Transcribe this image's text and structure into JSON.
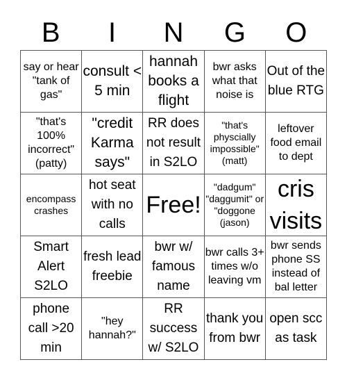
{
  "header": {
    "letters": [
      "B",
      "I",
      "N",
      "G",
      "O"
    ]
  },
  "board": {
    "rows": [
      [
        {
          "text": "say or hear \"tank of gas\"",
          "size": "s"
        },
        {
          "text": "consult < 5 min",
          "size": "l"
        },
        {
          "text": "hannah books a flight",
          "size": "l"
        },
        {
          "text": "bwr asks what that noise is",
          "size": "s"
        },
        {
          "text": "Out of the blue RTG",
          "size": "m"
        }
      ],
      [
        {
          "text": "\"that's 100% incorrect\" (patty)",
          "size": "s"
        },
        {
          "text": "\"credit Karma says\"",
          "size": "l"
        },
        {
          "text": "RR does not result in S2LO",
          "size": "m"
        },
        {
          "text": "\"that's physcially impossible\" (matt)",
          "size": "xs"
        },
        {
          "text": "leftover food email to dept",
          "size": "s"
        }
      ],
      [
        {
          "text": "encompass crashes",
          "size": "xs"
        },
        {
          "text": "hot seat with no calls",
          "size": "m"
        },
        {
          "text": "Free!",
          "size": "free",
          "free": true
        },
        {
          "text": "\"dadgum\" \"daggumit\" or \"doggone (jason)",
          "size": "xs"
        },
        {
          "text": "cris visits",
          "size": "xl"
        }
      ],
      [
        {
          "text": "Smart Alert S2LO",
          "size": "m"
        },
        {
          "text": "fresh lead freebie",
          "size": "m"
        },
        {
          "text": "bwr w/ famous name",
          "size": "m"
        },
        {
          "text": "bwr calls 3+ times w/o leaving vm",
          "size": "s"
        },
        {
          "text": "bwr sends phone SS instead of bal letter",
          "size": "s"
        }
      ],
      [
        {
          "text": "phone call >20 min",
          "size": "m"
        },
        {
          "text": "\"hey hannah?\"",
          "size": "s"
        },
        {
          "text": "RR success w/ S2LO",
          "size": "m"
        },
        {
          "text": "thank you from bwr",
          "size": "m"
        },
        {
          "text": "open scc as task",
          "size": "m"
        }
      ]
    ]
  }
}
